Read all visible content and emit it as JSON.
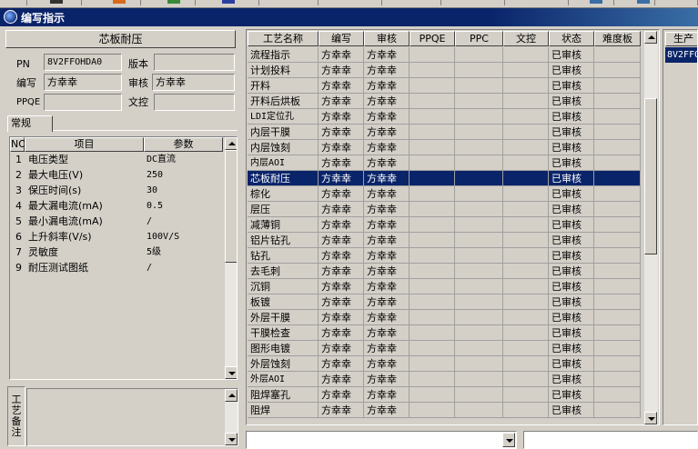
{
  "window": {
    "title": "编写指示",
    "icon": "app-globe-icon"
  },
  "board": {
    "title": "芯板耐压",
    "pn_label": "PN",
    "pn_value": "8V2FFOHDA0",
    "version_label": "版本",
    "version_value": "",
    "author_label": "编写",
    "author_value": "方幸幸",
    "reviewer_label": "审核",
    "reviewer_value": "方幸幸",
    "ppqe_label": "PPQE",
    "ppqe_value": "",
    "docctrl_label": "文控",
    "docctrl_value": ""
  },
  "tabs": [
    {
      "label": "常规"
    }
  ],
  "param_grid": {
    "headers": {
      "no": "NO",
      "item": "项目",
      "param": "参数"
    },
    "rows": [
      {
        "no": "1",
        "item": "电压类型",
        "value": "DC直流"
      },
      {
        "no": "2",
        "item": "最大电压(V)",
        "value": "250"
      },
      {
        "no": "3",
        "item": "保压时间(s)",
        "value": "30"
      },
      {
        "no": "4",
        "item": "最大漏电流(mA)",
        "value": "0.5"
      },
      {
        "no": "5",
        "item": "最小漏电流(mA)",
        "value": "/"
      },
      {
        "no": "6",
        "item": "上升斜率(V/s)",
        "value": "100V/S"
      },
      {
        "no": "7",
        "item": "灵敏度",
        "value": "5级"
      },
      {
        "no": "9",
        "item": "耐压测试图纸",
        "value": "/"
      }
    ]
  },
  "remark": {
    "label": "工艺备注",
    "value": ""
  },
  "process_grid": {
    "headers": [
      "工艺名称",
      "编写",
      "审核",
      "PPQE",
      "PPC",
      "文控",
      "状态",
      "难度板"
    ],
    "rows": [
      [
        "流程指示",
        "方幸幸",
        "方幸幸",
        "",
        "",
        "",
        "已审核",
        ""
      ],
      [
        "计划投料",
        "方幸幸",
        "方幸幸",
        "",
        "",
        "",
        "已审核",
        ""
      ],
      [
        "开料",
        "方幸幸",
        "方幸幸",
        "",
        "",
        "",
        "已审核",
        ""
      ],
      [
        "开料后烘板",
        "方幸幸",
        "方幸幸",
        "",
        "",
        "",
        "已审核",
        ""
      ],
      [
        "LDI定位孔",
        "方幸幸",
        "方幸幸",
        "",
        "",
        "",
        "已审核",
        ""
      ],
      [
        "内层干膜",
        "方幸幸",
        "方幸幸",
        "",
        "",
        "",
        "已审核",
        ""
      ],
      [
        "内层蚀刻",
        "方幸幸",
        "方幸幸",
        "",
        "",
        "",
        "已审核",
        ""
      ],
      [
        "内层AOI",
        "方幸幸",
        "方幸幸",
        "",
        "",
        "",
        "已审核",
        ""
      ],
      [
        "芯板耐压",
        "方幸幸",
        "方幸幸",
        "",
        "",
        "",
        "已审核",
        ""
      ],
      [
        "棕化",
        "方幸幸",
        "方幸幸",
        "",
        "",
        "",
        "已审核",
        ""
      ],
      [
        "层压",
        "方幸幸",
        "方幸幸",
        "",
        "",
        "",
        "已审核",
        ""
      ],
      [
        "减薄铜",
        "方幸幸",
        "方幸幸",
        "",
        "",
        "",
        "已审核",
        ""
      ],
      [
        "铝片钻孔",
        "方幸幸",
        "方幸幸",
        "",
        "",
        "",
        "已审核",
        ""
      ],
      [
        "钻孔",
        "方幸幸",
        "方幸幸",
        "",
        "",
        "",
        "已审核",
        ""
      ],
      [
        "去毛刺",
        "方幸幸",
        "方幸幸",
        "",
        "",
        "",
        "已审核",
        ""
      ],
      [
        "沉铜",
        "方幸幸",
        "方幸幸",
        "",
        "",
        "",
        "已审核",
        ""
      ],
      [
        "板镀",
        "方幸幸",
        "方幸幸",
        "",
        "",
        "",
        "已审核",
        ""
      ],
      [
        "外层干膜",
        "方幸幸",
        "方幸幸",
        "",
        "",
        "",
        "已审核",
        ""
      ],
      [
        "干膜检查",
        "方幸幸",
        "方幸幸",
        "",
        "",
        "",
        "已审核",
        ""
      ],
      [
        "图形电镀",
        "方幸幸",
        "方幸幸",
        "",
        "",
        "",
        "已审核",
        ""
      ],
      [
        "外层蚀刻",
        "方幸幸",
        "方幸幸",
        "",
        "",
        "",
        "已审核",
        ""
      ],
      [
        "外层AOI",
        "方幸幸",
        "方幸幸",
        "",
        "",
        "",
        "已审核",
        ""
      ],
      [
        "阻焊塞孔",
        "方幸幸",
        "方幸幸",
        "",
        "",
        "",
        "已审核",
        ""
      ],
      [
        "阻焊",
        "方幸幸",
        "方幸幸",
        "",
        "",
        "",
        "已审核",
        ""
      ]
    ],
    "selected_row": 8
  },
  "right_pane": {
    "header": "生产",
    "value": "8V2FFO"
  },
  "colors": {
    "face": "#d4d0c8",
    "selection": "#0a246a",
    "title_bar": "#0a246a"
  }
}
